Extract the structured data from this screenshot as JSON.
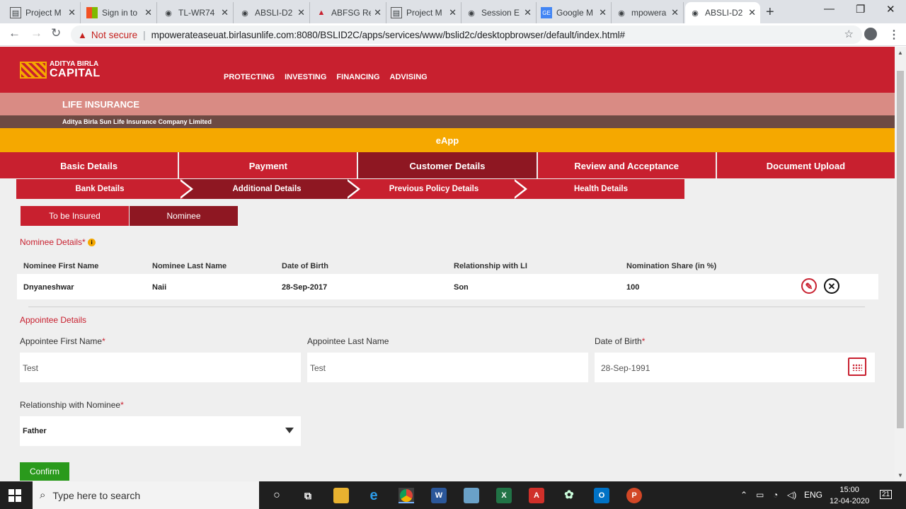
{
  "browser": {
    "tabs": [
      {
        "title": "Project M",
        "icon": "doc-icon"
      },
      {
        "title": "Sign in to",
        "icon": "microsoft-icon"
      },
      {
        "title": "TL-WR74",
        "icon": "globe-icon"
      },
      {
        "title": "ABSLI-D2",
        "icon": "globe-icon"
      },
      {
        "title": "ABFSG Re",
        "icon": "abc-icon"
      },
      {
        "title": "Project M",
        "icon": "doc-icon"
      },
      {
        "title": "Session E",
        "icon": "globe-icon"
      },
      {
        "title": "Google M",
        "icon": "google-sheets-icon"
      },
      {
        "title": "mpowera",
        "icon": "globe-icon"
      },
      {
        "title": "ABSLI-D2",
        "icon": "globe-icon",
        "active": true
      }
    ],
    "security": "Not secure",
    "url": "mpowerateaseuat.birlasunlife.com:8080/BSLID2C/apps/services/www/bslid2c/desktopbrowser/default/index.html#"
  },
  "header": {
    "logo_line1": "ADITYA BIRLA",
    "logo_line2": "CAPITAL",
    "nav": [
      "PROTECTING",
      "INVESTING",
      "FINANCING",
      "ADVISING"
    ],
    "life_insurance": "LIFE INSURANCE",
    "company": "Aditya Birla Sun Life Insurance Company Limited",
    "eapp": "eApp"
  },
  "steps": [
    {
      "label": "Basic Details"
    },
    {
      "label": "Payment"
    },
    {
      "label": "Customer Details",
      "active": true
    },
    {
      "label": "Review and Acceptance"
    },
    {
      "label": "Document Upload"
    }
  ],
  "substeps": [
    {
      "label": "Bank Details"
    },
    {
      "label": "Additional Details",
      "active": true
    },
    {
      "label": "Previous Policy Details"
    },
    {
      "label": "Health Details"
    }
  ],
  "subtabs": [
    {
      "label": "To be Insured"
    },
    {
      "label": "Nominee",
      "active": true
    }
  ],
  "nominee": {
    "title": "Nominee Details",
    "required_mark": "*",
    "info_icon": "i",
    "columns": [
      "Nominee First Name",
      "Nominee Last Name",
      "Date of Birth",
      "Relationship with LI",
      "Nomination Share (in %)"
    ],
    "rows": [
      [
        "Dnyaneshwar",
        "Naii",
        "28-Sep-2017",
        "Son",
        "100"
      ]
    ]
  },
  "appointee": {
    "title": "Appointee Details",
    "first_name_label": "Appointee First Name",
    "first_name": "Test",
    "last_name_label": "Appointee Last Name",
    "last_name": "Test",
    "dob_label": "Date of Birth",
    "dob": "28-Sep-1991",
    "relationship_label": "Relationship with Nominee",
    "relationship": "Father",
    "required_mark": "*"
  },
  "confirm_label": "Confirm",
  "taskbar": {
    "search_placeholder": "Type here to search",
    "lang": "ENG",
    "time": "15:00",
    "date": "12-04-2020",
    "notifications": "21"
  },
  "colors": {
    "brand_red": "#c8202f",
    "brand_dark": "#8e1722",
    "accent": "#f5a800",
    "confirm": "#2a9a1c"
  }
}
